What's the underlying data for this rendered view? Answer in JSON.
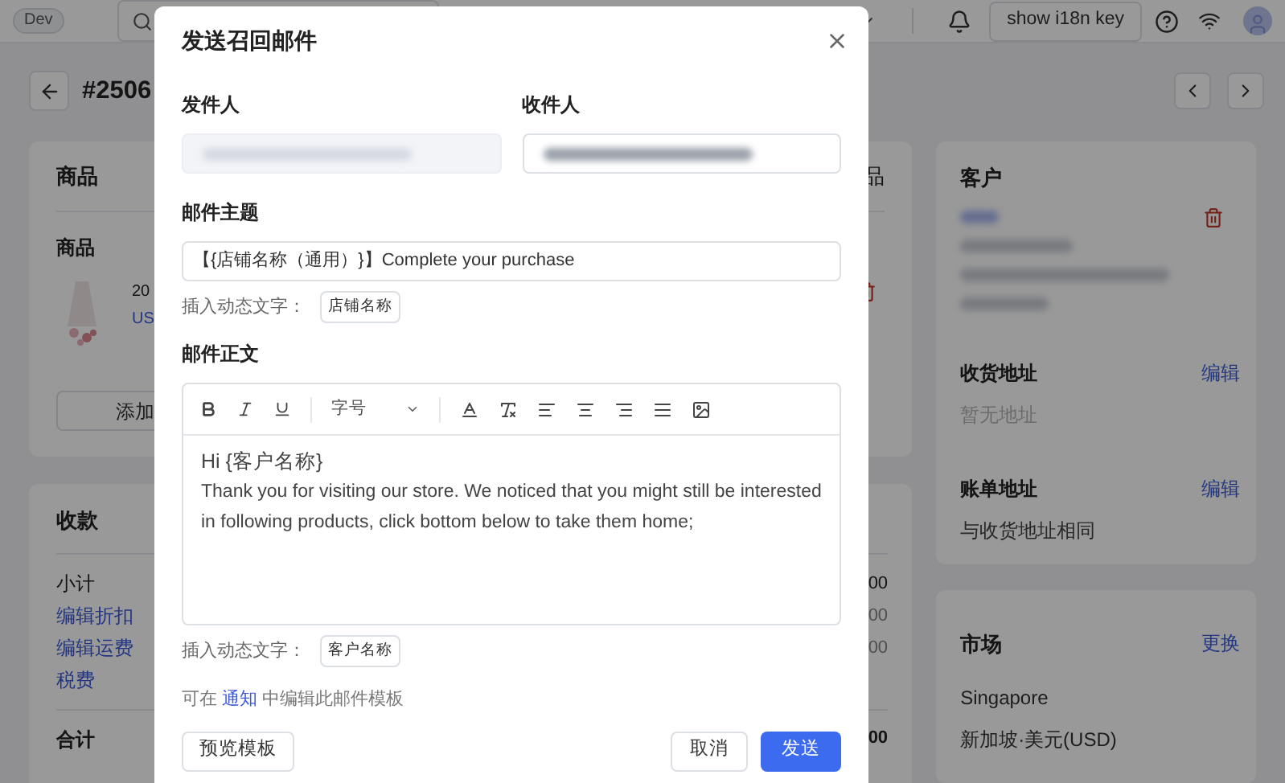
{
  "top_bar": {
    "env_badge": "Dev",
    "i18n_button": "show i18n key"
  },
  "page": {
    "order_number": "#2506",
    "products_card": {
      "title": "商品",
      "header_action": "品",
      "section_label": "商品",
      "item_title": "20",
      "item_price": "US",
      "add_button": "添加"
    },
    "payment_card": {
      "title": "收款",
      "rows": [
        {
          "label": "小计",
          "kind": "plain",
          "amount": "00"
        },
        {
          "label": "编辑折扣",
          "kind": "link",
          "amount": "00"
        },
        {
          "label": "编辑运费",
          "kind": "link",
          "amount": "00"
        },
        {
          "label": "税费",
          "kind": "link"
        }
      ],
      "total": {
        "label": "合计",
        "amount": "00"
      }
    },
    "customer_card": {
      "title": "客户",
      "sections": [
        {
          "title": "收货地址",
          "action": "编辑",
          "text": "暂无地址",
          "muted": true
        },
        {
          "title": "账单地址",
          "action": "编辑",
          "text": "与收货地址相同",
          "muted": false
        }
      ]
    },
    "market_card": {
      "title": "市场",
      "action": "更换",
      "lines": [
        "Singapore",
        "新加坡·美元(USD)"
      ]
    }
  },
  "dialog": {
    "title": "发送召回邮件",
    "sender": {
      "label": "发件人",
      "disabled": true
    },
    "recipient": {
      "label": "收件人",
      "disabled": false
    },
    "subject": {
      "label": "邮件主题",
      "value": "【{店铺名称（通用）}】Complete your purchase",
      "insert_label": "插入动态文字：",
      "tokens": [
        "店铺名称"
      ]
    },
    "body": {
      "label": "邮件正文",
      "font_size_select": "字号",
      "greeting": "Hi {客户名称}",
      "paragraph": "Thank you for visiting our store. We noticed that you might still be interested in following products, click bottom below to take them home;",
      "insert_label": "插入动态文字：",
      "tokens": [
        "客户名称"
      ]
    },
    "notice": {
      "before": "可在",
      "link": "通知",
      "after": "中编辑此邮件模板"
    },
    "buttons": {
      "preview": "预览模板",
      "cancel": "取消",
      "send": "发送"
    }
  }
}
